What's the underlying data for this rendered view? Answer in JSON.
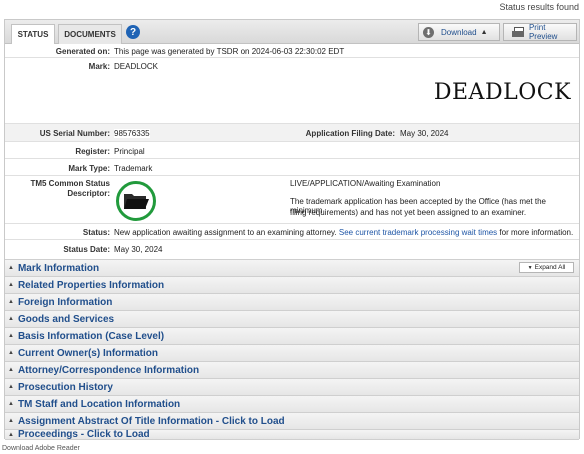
{
  "results_found": "Status results found",
  "tabs": [
    {
      "label": "STATUS"
    },
    {
      "label": "DOCUMENTS"
    }
  ],
  "help_icon": "?",
  "download_label": "Download",
  "print_label": "Print Preview",
  "fields": {
    "generated_on_label": "Generated on:",
    "generated_on_value": "This page was generated by TSDR on 2024-06-03 22:30:02 EDT",
    "mark_label": "Mark:",
    "mark_value": "DEADLOCK",
    "mark_image_text": "DEADLOCK",
    "serial_label": "US Serial Number:",
    "serial_value": "98576335",
    "filing_date_label": "Application Filing Date:",
    "filing_date_value": "May 30, 2024",
    "register_label": "Register:",
    "register_value": "Principal",
    "mark_type_label": "Mark Type:",
    "mark_type_value": "Trademark",
    "tm5_label_line1": "TM5 Common Status",
    "tm5_label_line2": "Descriptor:",
    "tm5_status": "LIVE/APPLICATION/Awaiting Examination",
    "tm5_desc_line1": "The trademark application has been accepted by the Office (has met the minimum",
    "tm5_desc_line2": "filing requirements) and has not yet been assigned to an examiner.",
    "status_label": "Status:",
    "status_text": "New application awaiting assignment to an examining attorney.",
    "status_link": "See current trademark processing wait times",
    "status_suffix": "for more information.",
    "status_date_label": "Status Date:",
    "status_date_value": "May 30, 2024"
  },
  "expand_all_label": "Expand All",
  "sections": [
    {
      "label": "Mark Information"
    },
    {
      "label": "Related Properties Information"
    },
    {
      "label": "Foreign Information"
    },
    {
      "label": "Goods and Services"
    },
    {
      "label": "Basis Information (Case Level)"
    },
    {
      "label": "Current Owner(s) Information"
    },
    {
      "label": "Attorney/Correspondence Information"
    },
    {
      "label": "Prosecution History"
    },
    {
      "label": "TM Staff and Location Information"
    },
    {
      "label": "Assignment Abstract Of Title Information - Click to Load"
    },
    {
      "label": "Proceedings - Click to Load"
    }
  ],
  "footer_text": "Download Adobe Reader",
  "colors": {
    "accent": "#214f8c",
    "status_green": "#219a3c",
    "link": "#1f56a6"
  }
}
